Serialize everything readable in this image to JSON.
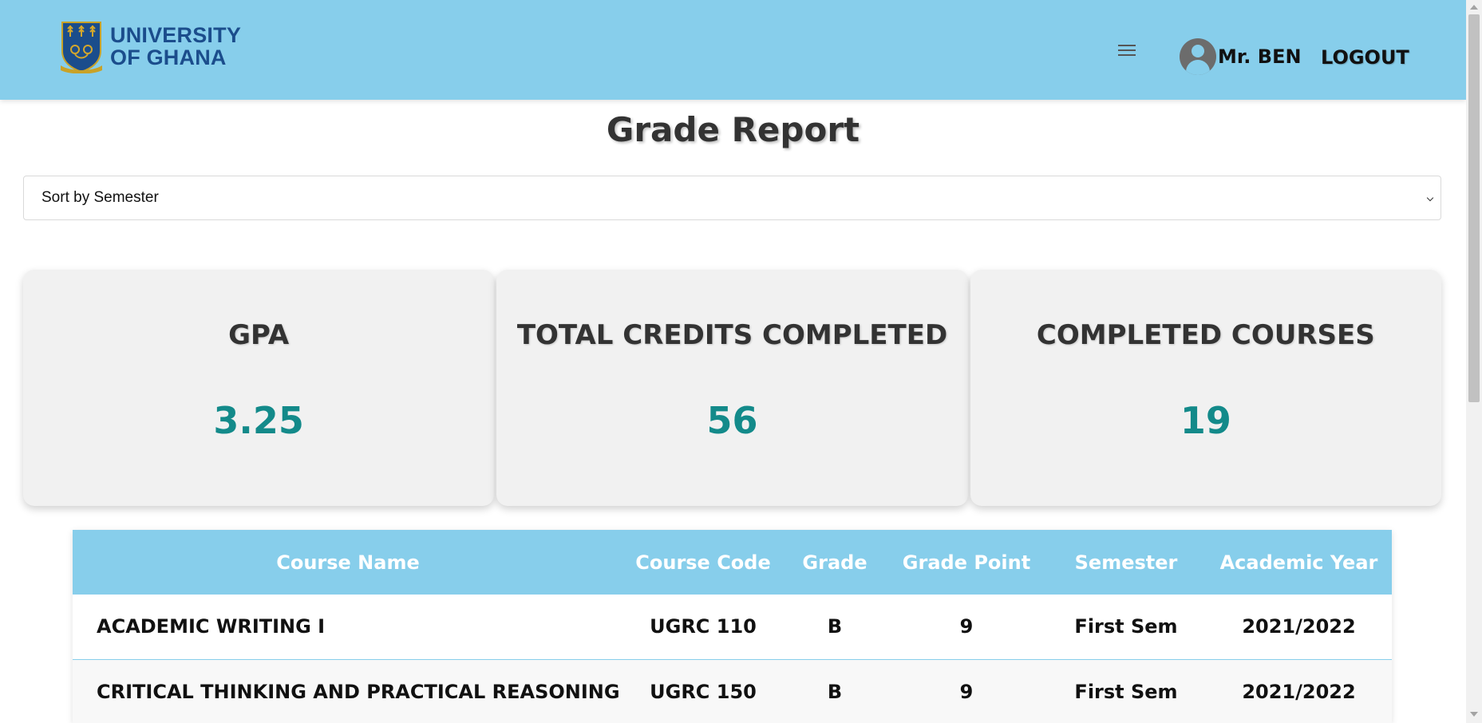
{
  "header": {
    "logo_line1": "UNIVERSITY",
    "logo_line2": "OF GHANA",
    "menu_icon": "hamburger-icon",
    "user_icon": "user-circle-icon",
    "user_name": "Mr. BEN",
    "logout_label": "LOGOUT",
    "bg_color": "#87ceeb"
  },
  "page": {
    "title": "Grade Report"
  },
  "sort": {
    "selected": "Sort by Semester"
  },
  "stats": [
    {
      "label": "GPA",
      "value": "3.25"
    },
    {
      "label": "TOTAL CREDITS COMPLETED",
      "value": "56"
    },
    {
      "label": "COMPLETED COURSES",
      "value": "19"
    }
  ],
  "stat_value_color": "#138a8a",
  "table": {
    "columns": [
      "Course Name",
      "Course Code",
      "Grade",
      "Grade Point",
      "Semester",
      "Academic Year"
    ],
    "rows": [
      {
        "course_name": "ACADEMIC WRITING I",
        "course_code": "UGRC 110",
        "grade": "B",
        "grade_point": "9",
        "semester": "First Sem",
        "academic_year": "2021/2022"
      },
      {
        "course_name": "CRITICAL THINKING AND PRACTICAL REASONING",
        "course_code": "UGRC 150",
        "grade": "B",
        "grade_point": "9",
        "semester": "First Sem",
        "academic_year": "2021/2022"
      }
    ]
  }
}
